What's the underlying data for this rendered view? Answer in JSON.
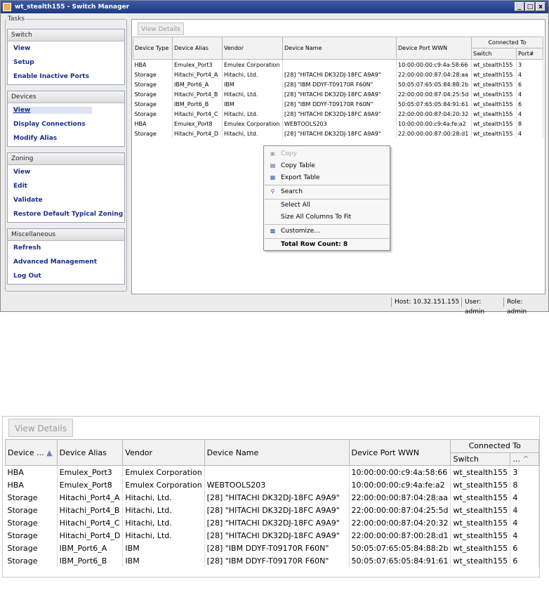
{
  "window": {
    "title": "wt_stealth155 - Switch Manager",
    "buttons": [
      "_",
      "□",
      "x"
    ]
  },
  "tasks": {
    "label": "Tasks",
    "groups": [
      {
        "header": "Switch",
        "items": [
          "View",
          "Setup",
          "Enable Inactive Ports"
        ]
      },
      {
        "header": "Devices",
        "items": [
          "View",
          "Display Connections",
          "Modify Alias"
        ]
      },
      {
        "header": "Zoning",
        "items": [
          "View",
          "Edit",
          "Validate",
          "Restore Default Typical Zoning"
        ]
      },
      {
        "header": "Miscellaneous",
        "items": [
          "Refresh",
          "Advanced Management",
          "Log Out"
        ]
      }
    ]
  },
  "main": {
    "view_details_label": "View Details",
    "columns": [
      "Device Type",
      "Device Alias",
      "Vendor",
      "Device Name",
      "Device Port WWN"
    ],
    "connected_to": "Connected To",
    "switch_col": "Switch",
    "port_col": "Port#",
    "rows": [
      [
        "HBA",
        "Emulex_Port3",
        "Emulex Corporation",
        "",
        "10:00:00:00:c9:4a:58:66",
        "wt_stealth155",
        "3"
      ],
      [
        "Storage",
        "Hitachi_Port4_A",
        "Hitachi, Ltd.",
        "[28] \"HITACHI DK32DJ-18FC     A9A9\"",
        "22:00:00:00:87:04:28:aa",
        "wt_stealth155",
        "4"
      ],
      [
        "Storage",
        "IBM_Port6_A",
        "IBM",
        "[28] \"IBM     DDYF-T09170R     F60N\"",
        "50:05:07:65:05:84:88:2b",
        "wt_stealth155",
        "6"
      ],
      [
        "Storage",
        "Hitachi_Port4_B",
        "Hitachi, Ltd.",
        "[28] \"HITACHI DK32DJ-18FC     A9A9\"",
        "22:00:00:00:87:04:25:5d",
        "wt_stealth155",
        "4"
      ],
      [
        "Storage",
        "IBM_Port6_B",
        "IBM",
        "[28] \"IBM     DDYF-T09170R     F60N\"",
        "50:05:07:65:05:84:91:61",
        "wt_stealth155",
        "6"
      ],
      [
        "Storage",
        "Hitachi_Port4_C",
        "Hitachi, Ltd.",
        "[28] \"HITACHI DK32DJ-18FC     A9A9\"",
        "22:00:00:00:87:04:20:32",
        "wt_stealth155",
        "4"
      ],
      [
        "HBA",
        "Emulex_Port8",
        "Emulex Corporation",
        "WEBTOOLS203",
        "10:00:00:00:c9:4a:fe:a2",
        "wt_stealth155",
        "8"
      ],
      [
        "Storage",
        "Hitachi_Port4_D",
        "Hitachi, Ltd.",
        "[28] \"HITACHI DK32DJ-18FC     A9A9\"",
        "22:00:00:00:87:00:28:d1",
        "wt_stealth155",
        "4"
      ]
    ]
  },
  "context_menu": {
    "copy": "Copy",
    "copy_table": "Copy Table",
    "export_table": "Export Table",
    "search": "Search",
    "select_all": "Select All",
    "size_all": "Size All Columns To Fit",
    "customize": "Customize...",
    "total": "Total Row Count: 8"
  },
  "status": {
    "host": "Host: 10.32.151.155",
    "user": "User: admin",
    "role": "Role: admin"
  },
  "zoomed": {
    "view_details_label": "View Details",
    "columns": [
      "Device ...",
      "Device Alias",
      "Vendor",
      "Device Name",
      "Device Port WWN"
    ],
    "connected_to": "Connected To",
    "switch_col": "Switch",
    "port_col": "...",
    "rows": [
      [
        "HBA",
        "Emulex_Port3",
        "Emulex Corporation",
        "",
        "10:00:00:00:c9:4a:58:66",
        "wt_stealth155",
        "3"
      ],
      [
        "HBA",
        "Emulex_Port8",
        "Emulex Corporation",
        "WEBTOOLS203",
        "10:00:00:00:c9:4a:fe:a2",
        "wt_stealth155",
        "8"
      ],
      [
        "Storage",
        "Hitachi_Port4_A",
        "Hitachi, Ltd.",
        "[28] \"HITACHI DK32DJ-18FC     A9A9\"",
        "22:00:00:00:87:04:28:aa",
        "wt_stealth155",
        "4"
      ],
      [
        "Storage",
        "Hitachi_Port4_B",
        "Hitachi, Ltd.",
        "[28] \"HITACHI DK32DJ-18FC     A9A9\"",
        "22:00:00:00:87:04:25:5d",
        "wt_stealth155",
        "4"
      ],
      [
        "Storage",
        "Hitachi_Port4_C",
        "Hitachi, Ltd.",
        "[28] \"HITACHI DK32DJ-18FC     A9A9\"",
        "22:00:00:00:87:04:20:32",
        "wt_stealth155",
        "4"
      ],
      [
        "Storage",
        "Hitachi_Port4_D",
        "Hitachi, Ltd.",
        "[28] \"HITACHI DK32DJ-18FC     A9A9\"",
        "22:00:00:00:87:00:28:d1",
        "wt_stealth155",
        "4"
      ],
      [
        "Storage",
        "IBM_Port6_A",
        "IBM",
        "[28] \"IBM     DDYF-T09170R     F60N\"",
        "50:05:07:65:05:84:88:2b",
        "wt_stealth155",
        "6"
      ],
      [
        "Storage",
        "IBM_Port6_B",
        "IBM",
        "[28] \"IBM     DDYF-T09170R     F60N\"",
        "50:05:07:65:05:84:91:61",
        "wt_stealth155",
        "6"
      ]
    ]
  }
}
